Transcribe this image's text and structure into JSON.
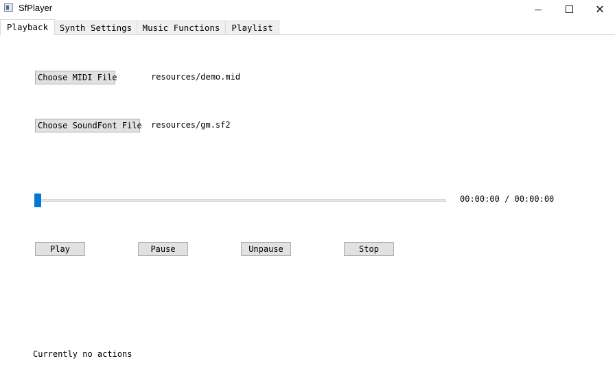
{
  "window": {
    "title": "SfPlayer",
    "icons": {
      "app": "app-icon",
      "minimize": "minimize-icon",
      "maximize": "maximize-icon",
      "close": "close-icon"
    },
    "close_glyph": "✕"
  },
  "tabs": [
    {
      "label": "Playback",
      "active": true
    },
    {
      "label": "Synth Settings",
      "active": false
    },
    {
      "label": "Music Functions",
      "active": false
    },
    {
      "label": "Playlist",
      "active": false
    }
  ],
  "playback": {
    "choose_midi_label": "Choose MIDI File",
    "midi_path": "resources/demo.mid",
    "choose_soundfont_label": "Choose SoundFont File",
    "soundfont_path": "resources/gm.sf2",
    "progress": {
      "value": 0,
      "time_text": "00:00:00 / 00:00:00"
    },
    "buttons": {
      "play": "Play",
      "pause": "Pause",
      "unpause": "Unpause",
      "stop": "Stop"
    },
    "status": "Currently no actions"
  },
  "colors": {
    "accent": "#0078d7",
    "button_bg": "#e1e1e1",
    "tab_bg": "#f0f0f0"
  }
}
